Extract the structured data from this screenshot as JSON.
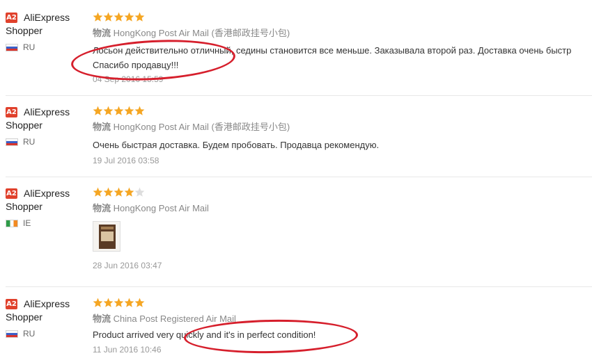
{
  "reviews": [
    {
      "badge": "A2",
      "user_line1": "AliExpress",
      "user_line2": "Shopper",
      "country": "RU",
      "stars": 5,
      "shipping_cn": "物流",
      "shipping": "HongKong Post Air Mail (香港邮政挂号小包)",
      "text_line1": "Лосьон действительно отличный, седины становится все меньше. Заказывала второй раз. Доставка очень быстр",
      "text_line2": "Спасибо продавцу!!!",
      "date": "04 Sep 2016 15:59"
    },
    {
      "badge": "A2",
      "user_line1": "AliExpress",
      "user_line2": "Shopper",
      "country": "RU",
      "stars": 5,
      "shipping_cn": "物流",
      "shipping": "HongKong Post Air Mail (香港邮政挂号小包)",
      "text_line1": "Очень быстрая доставка. Будем пробовать. Продавца рекомендую.",
      "date": "19 Jul 2016 03:58"
    },
    {
      "badge": "A2",
      "user_line1": "AliExpress",
      "user_line2": "Shopper",
      "country": "IE",
      "stars": 4,
      "shipping_cn": "物流",
      "shipping": "HongKong Post Air Mail",
      "date": "28 Jun 2016 03:47"
    },
    {
      "badge": "A2",
      "user_line1": "AliExpress",
      "user_line2": "Shopper",
      "country": "RU",
      "stars": 5,
      "shipping_cn": "物流",
      "shipping": "China Post Registered Air Mail",
      "text_line1": "Product arrived very quickly and it's in perfect condition!",
      "date": "11 Jun 2016 10:46"
    }
  ],
  "colors": {
    "star_filled": "#f5a623",
    "star_empty": "#dddddd",
    "badge": "#e0412c",
    "annotation": "#d61f2c"
  }
}
